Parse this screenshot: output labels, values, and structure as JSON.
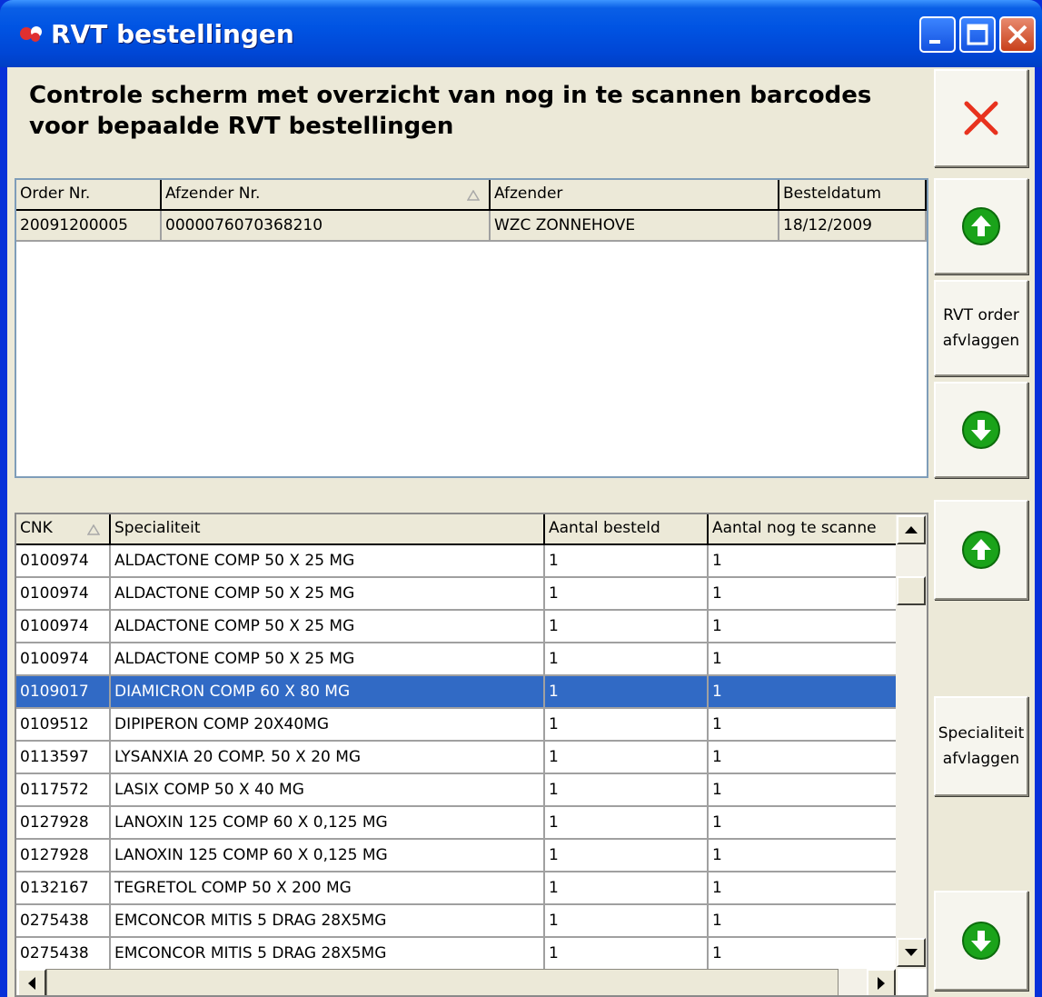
{
  "window": {
    "title": "RVT bestellingen"
  },
  "heading": "Controle scherm met overzicht van nog in te scannen barcodes voor bepaalde RVT bestellingen",
  "orders": {
    "columns": [
      "Order Nr.",
      "Afzender Nr.",
      "Afzender",
      "Besteldatum"
    ],
    "rows": [
      [
        "20091200005",
        "0000076070368210",
        "WZC ZONNEHOVE",
        "18/12/2009"
      ]
    ]
  },
  "items": {
    "columns": [
      "CNK",
      "Specialiteit",
      "Aantal besteld",
      "Aantal nog te scanne"
    ],
    "selected_index": 4,
    "rows": [
      [
        "0100974",
        "ALDACTONE COMP  50 X  25 MG",
        "1",
        "1"
      ],
      [
        "0100974",
        "ALDACTONE COMP  50 X  25 MG",
        "1",
        "1"
      ],
      [
        "0100974",
        "ALDACTONE COMP  50 X  25 MG",
        "1",
        "1"
      ],
      [
        "0100974",
        "ALDACTONE COMP  50 X  25 MG",
        "1",
        "1"
      ],
      [
        "0109017",
        "DIAMICRON COMP  60 X 80 MG",
        "1",
        "1"
      ],
      [
        "0109512",
        "DIPIPERON COMP 20X40MG",
        "1",
        "1"
      ],
      [
        "0113597",
        "LYSANXIA 20 COMP.  50 X 20 MG",
        "1",
        "1"
      ],
      [
        "0117572",
        "LASIX COMP  50 X 40 MG",
        "1",
        "1"
      ],
      [
        "0127928",
        "LANOXIN 125 COMP   60 X 0,125 MG",
        "1",
        "1"
      ],
      [
        "0127928",
        "LANOXIN 125 COMP   60 X 0,125 MG",
        "1",
        "1"
      ],
      [
        "0132167",
        "TEGRETOL COMP  50 X 200 MG",
        "1",
        "1"
      ],
      [
        "0275438",
        "EMCONCOR MITIS 5 DRAG 28X5MG",
        "1",
        "1"
      ],
      [
        "0275438",
        "EMCONCOR MITIS 5 DRAG 28X5MG",
        "1",
        "1"
      ]
    ]
  },
  "buttons": {
    "rvt_order_afvlaggen": "RVT order\nafvlaggen",
    "specialiteit_afvlaggen": "Specialiteit\nafvlaggen"
  },
  "colors": {
    "accent_green": "#1aa31a",
    "close_red": "#e8321e",
    "selection": "#316ac5"
  },
  "icons": [
    "app-icon",
    "minimize-icon",
    "maximize-icon",
    "close-icon",
    "arrow-up-icon",
    "arrow-down-icon"
  ]
}
